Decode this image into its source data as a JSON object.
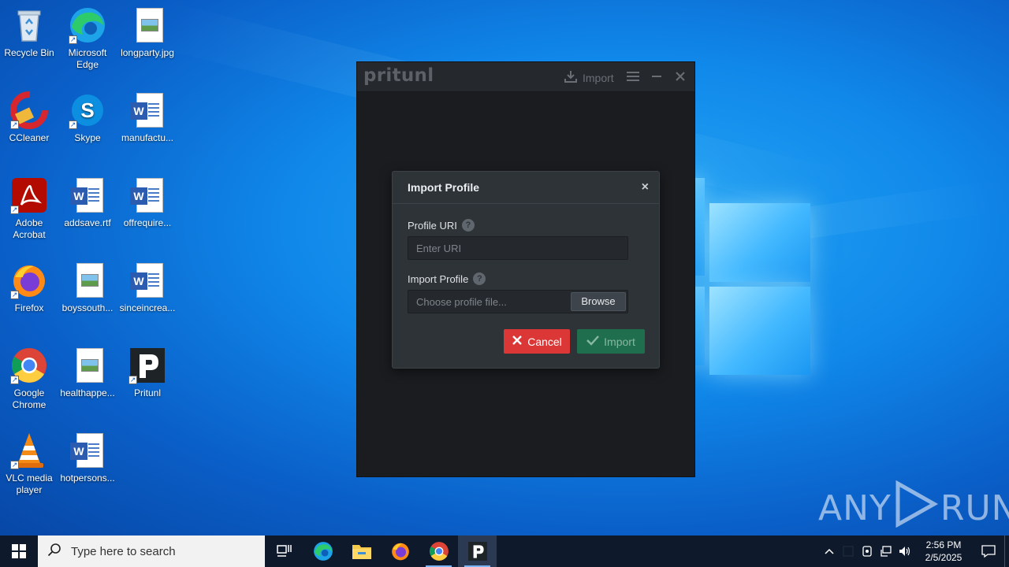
{
  "desktop": {
    "icons": [
      {
        "label": "Recycle Bin",
        "icon": "recycle-bin-icon"
      },
      {
        "label": "Microsoft Edge",
        "icon": "edge-icon"
      },
      {
        "label": "longparty.jpg",
        "icon": "image-file-icon"
      },
      {
        "label": "CCleaner",
        "icon": "ccleaner-icon"
      },
      {
        "label": "Skype",
        "icon": "skype-icon"
      },
      {
        "label": "manufactu...",
        "icon": "word-document-icon"
      },
      {
        "label": "Adobe Acrobat",
        "icon": "acrobat-icon"
      },
      {
        "label": "addsave.rtf",
        "icon": "word-document-icon"
      },
      {
        "label": "offrequire...",
        "icon": "word-document-icon"
      },
      {
        "label": "Firefox",
        "icon": "firefox-icon"
      },
      {
        "label": "boyssouth...",
        "icon": "image-file-icon"
      },
      {
        "label": "sinceincrea...",
        "icon": "word-document-icon"
      },
      {
        "label": "Google Chrome",
        "icon": "chrome-icon"
      },
      {
        "label": "healthappe...",
        "icon": "image-file-icon"
      },
      {
        "label": "Pritunl",
        "icon": "pritunl-icon"
      },
      {
        "label": "VLC media player",
        "icon": "vlc-icon"
      },
      {
        "label": "hotpersons...",
        "icon": "word-document-icon"
      }
    ]
  },
  "app": {
    "brand": "pritunl",
    "toolbar": {
      "import_label": "Import"
    }
  },
  "modal": {
    "title": "Import Profile",
    "close_glyph": "×",
    "uri_label": "Profile URI",
    "uri_placeholder": "Enter URI",
    "file_label": "Import Profile",
    "file_placeholder": "Choose profile file...",
    "browse_label": "Browse",
    "cancel_label": "Cancel",
    "import_label": "Import",
    "help_glyph": "?"
  },
  "watermark": {
    "left": "ANY",
    "right": "RUN"
  },
  "taskbar": {
    "search_placeholder": "Type here to search",
    "pinned": [
      "task-view-icon",
      "edge-icon",
      "file-explorer-icon",
      "firefox-icon",
      "chrome-icon",
      "pritunl-icon"
    ],
    "clock_time": "2:56 PM",
    "clock_date": "2/5/2025"
  },
  "colors": {
    "cancel": "#db3737",
    "import": "#1f6e4d",
    "modal_bg": "#2e3338",
    "taskbar": "#0e1a2b"
  }
}
